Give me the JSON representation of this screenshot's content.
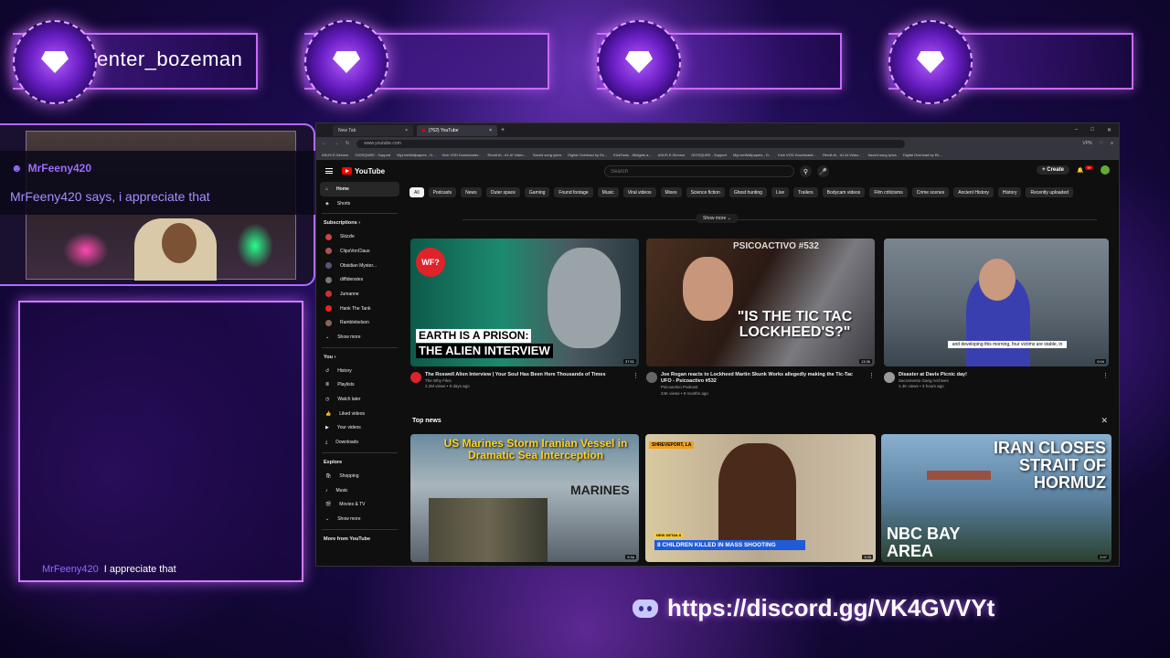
{
  "overlay": {
    "badges": [
      "enter_bozeman",
      "",
      "",
      ""
    ],
    "chat_popup": {
      "user": "MrFeeny420",
      "message": "MrFeeny420 says, i appreciate that"
    },
    "chat_log": [
      {
        "user": "MrFeeny420",
        "message": "I appreciate that"
      }
    ],
    "discord_link": "https://discord.gg/VK4GVVYt"
  },
  "browser": {
    "tabs": [
      {
        "label": "New Tab",
        "active": false
      },
      {
        "label": "(762) YouTube",
        "active": true
      }
    ],
    "url": "www.youtube.com",
    "vpn_label": "VPN",
    "bookmarks": [
      "ASUS E-Service",
      "GIGSQUBS - Support",
      "MyLiveWallpapers - D...",
      "Kick VOD Downloader...",
      "Remit AI - #1 AI Video...",
      "Saved song lyrics",
      "Digital Overload by Ek...",
      "KickTools - Widgets a...",
      "ASUS E-Service",
      "GIGSQUBS - Support",
      "MyLiveWallpapers - D...",
      "Kick VOD Downloade...",
      "Remit AI - #1 AI Video...",
      "Saved song lyrics",
      "Digital Overload by Ek..."
    ]
  },
  "youtube": {
    "logo": "YouTube",
    "search_placeholder": "Search",
    "create_label": "Create",
    "notif_count": "9+",
    "sidebar": {
      "main": [
        "Home",
        "Shorts"
      ],
      "subscriptions_label": "Subscriptions",
      "subscriptions": [
        "Skizzle",
        "ClipsVonClaus",
        "Obsidian Myster...",
        "diffidenstes",
        "Jumanne",
        "Hank The Tank",
        "Ramblebelson"
      ],
      "show_more": "Show more",
      "you_label": "You",
      "you_items": [
        "History",
        "Playlists",
        "Watch later",
        "Liked videos",
        "Your videos",
        "Downloads"
      ],
      "explore_label": "Explore",
      "explore_items": [
        "Shopping",
        "Music",
        "Movies & TV"
      ],
      "explore_show_more": "Show more",
      "more_from": "More from YouTube"
    },
    "chips": [
      "All",
      "Podcasts",
      "News",
      "Outer space",
      "Gaming",
      "Found footage",
      "Music",
      "Viral videos",
      "Mixes",
      "Science fiction",
      "Ghost hunting",
      "Live",
      "Trailers",
      "Bodycam videos",
      "Film criticisms",
      "Crime scenes",
      "Ancient History",
      "History",
      "Recently uploaded"
    ],
    "show_more_label": "Show more",
    "videos": [
      {
        "title": "The Roswell Alien Interview | Your Soul Has Been Here Thousands of Times",
        "channel": "The Why Files",
        "stats": "2.2M views • 9 days ago",
        "duration": "37:51",
        "thumb_text_1": "EARTH IS A PRISON:",
        "thumb_text_2": "THE ALIEN INTERVIEW",
        "logo": "WF?"
      },
      {
        "title": "Joe Rogan reacts to Lockheed Martin Skunk Works allegedly making the Tic-Tac UFO - Psicoactivo #532",
        "channel": "Psicoactivo Podcast",
        "stats": "24K views • 8 months ago",
        "duration": "13:36",
        "thumb_text_1": "PSICOACTIVO #532",
        "thumb_text_2": "\"IS THE TIC TAC LOCKHEED'S?\""
      },
      {
        "title": "Disaster at Davis Picnic day!",
        "channel": "Sacramento Gang Archives",
        "stats": "1.4K views • 3 hours ago",
        "duration": "0:04",
        "caption": "and developing this morning, four victims are stable, in"
      }
    ],
    "top_news_label": "Top news",
    "news": [
      {
        "headline": "US Marines Storm Iranian Vessel in Dramatic Sea Interception",
        "duration": "9:34",
        "side_text": "MARINES"
      },
      {
        "headline": "8 CHILDREN KILLED IN MASS SHOOTING",
        "tag": "NEW DETAILS",
        "source": "SHREVEPORT, LA",
        "duration": "3:39"
      },
      {
        "headline": "IRAN CLOSES STRAIT OF HORMUZ",
        "brand": "NBC BAY AREA",
        "duration": "2:07"
      }
    ]
  }
}
